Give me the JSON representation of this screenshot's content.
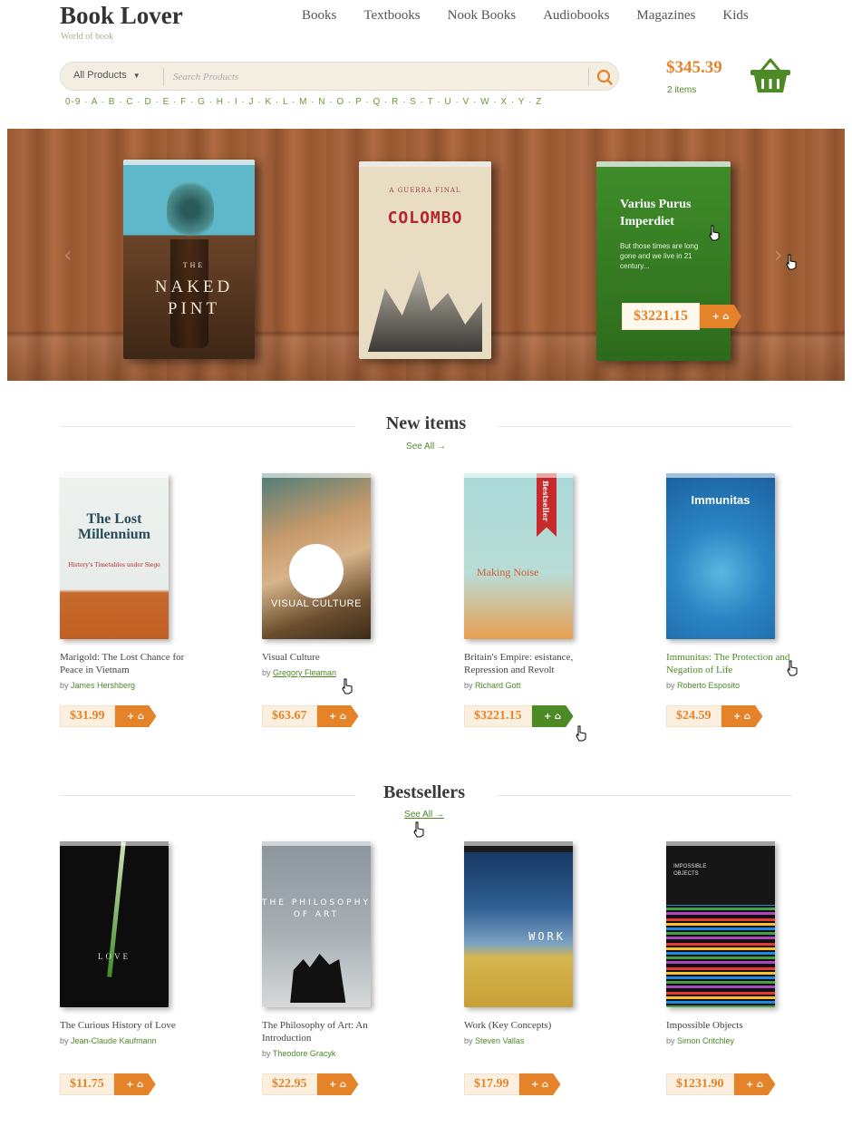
{
  "header": {
    "logo": "Book Lover",
    "tagline": "World of book",
    "nav": [
      "Books",
      "Textbooks",
      "Nook Books",
      "Audiobooks",
      "Magazines",
      "Kids"
    ]
  },
  "search": {
    "category": "All Products",
    "placeholder": "Search Products",
    "alphabet": "0-9 · A · B · C · D · E · F · G · H · I · J · K · L · M · N · O · P · Q · R · S · T · U · V · W · X · Y · Z"
  },
  "cart": {
    "total": "$345.39",
    "items": "2 items"
  },
  "carousel": {
    "books": [
      {
        "title_lines": [
          "THE",
          "NAKED",
          "PINT"
        ]
      },
      {
        "title": "COLOMBO",
        "subtitle": "A GUERRA FINAL"
      },
      {
        "title": "Varius Purus Imperdiet",
        "description": "But those times are long gone and we live in 21 century...",
        "price": "$3221.15"
      }
    ]
  },
  "new_items": {
    "heading": "New items",
    "see_all": "See All →",
    "products": [
      {
        "title": "Marigold: The Lost Chance for Peace in Vietnam",
        "author": "James Hershberg",
        "price": "$31.99",
        "cover_title": "The Lost Millennium",
        "cover_subtitle": "History's Timetables under Siege"
      },
      {
        "title": "Visual Culture",
        "author": "Gregory Fleaman",
        "price": "$63.67",
        "cover_title": "VISUAL CULTURE"
      },
      {
        "title": "Britain's Empire: esistance, Repression and Revolt",
        "author": "Richard Gott",
        "price": "$3221.15",
        "cover_title": "Making Noise",
        "badge": "Bestseller"
      },
      {
        "title": "Immunitas: The Protection and Negation of Life",
        "author": "Roberto Esposito",
        "price": "$24.59",
        "cover_title": "Immunitas"
      }
    ]
  },
  "bestsellers": {
    "heading": "Bestsellers",
    "see_all": "See All →",
    "products": [
      {
        "title": "The Curious History of Love",
        "author": "Jean-Claude Kaufmann",
        "price": "$11.75",
        "cover_title": "LOVE"
      },
      {
        "title": "The Philosophy of Art: An Introduction",
        "author": "Theodore Gracyk",
        "price": "$22.95",
        "cover_title": "THE PHILOSOPHY OF ART"
      },
      {
        "title": "Work (Key Concepts)",
        "author": "Steven Vallas",
        "price": "$17.99",
        "cover_title": "WORK"
      },
      {
        "title": "Impossible Objects",
        "author": "Simon Critchley",
        "price": "$1231.90",
        "cover_title": "IMPOSSIBLE OBJECTS"
      }
    ]
  },
  "labels": {
    "by": "by ",
    "add_to_cart": "+ ⌂"
  },
  "colors": {
    "accent_orange": "#e5832a",
    "accent_green": "#4c8a25",
    "text_dark": "#3a3a3a"
  }
}
